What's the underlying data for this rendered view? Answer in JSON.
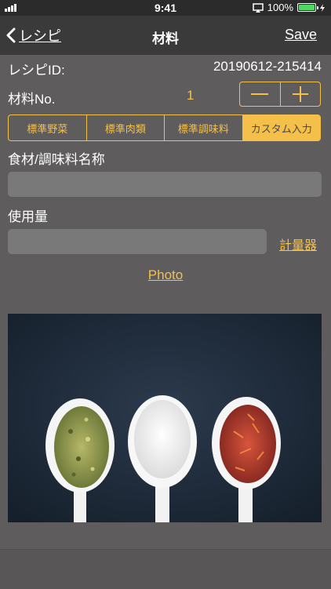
{
  "status_bar": {
    "time": "9:41",
    "battery_percent": "100%"
  },
  "nav": {
    "back_label": "レシピ",
    "title": "材料",
    "save_label": "Save"
  },
  "recipe_id": {
    "label": "レシピID:",
    "value": "20190612-215414"
  },
  "ingredient_no": {
    "label": "材料No.",
    "value": "1",
    "minus": "−",
    "plus": "+"
  },
  "segments": [
    {
      "label": "標準野菜",
      "selected": false
    },
    {
      "label": "標準肉類",
      "selected": false
    },
    {
      "label": "標準調味料",
      "selected": false
    },
    {
      "label": "カスタム入力",
      "selected": true
    }
  ],
  "name_field": {
    "label": "食材/調味料名称",
    "value": ""
  },
  "amount_field": {
    "label": "使用量",
    "value": "",
    "scale_link": "計量器"
  },
  "photo_link": "Photo",
  "colors": {
    "accent": "#f5c04a",
    "background": "#5e5c5c",
    "nav": "#3a3a3a",
    "field": "#7a7979"
  }
}
